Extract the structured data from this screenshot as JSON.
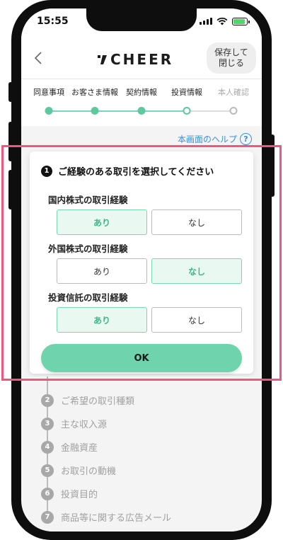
{
  "status_bar": {
    "time": "15:55"
  },
  "header": {
    "logo_text": "CHEER",
    "save_button": "保存して\n閉じる"
  },
  "steps": [
    {
      "label": "同意事項",
      "state": "done"
    },
    {
      "label": "お客さま情報",
      "state": "done"
    },
    {
      "label": "契約情報",
      "state": "done"
    },
    {
      "label": "投資情報",
      "state": "current"
    },
    {
      "label": "本人確認",
      "state": "future"
    }
  ],
  "help": {
    "label": "本画面のヘルプ",
    "icon_text": "?"
  },
  "question": {
    "number": "1",
    "title": "ご経験のある取引を選択してください",
    "groups": [
      {
        "label": "国内株式の取引経験",
        "options": [
          "あり",
          "なし"
        ],
        "selected": "あり"
      },
      {
        "label": "外国株式の取引経験",
        "options": [
          "あり",
          "なし"
        ],
        "selected": "なし"
      },
      {
        "label": "投資信託の取引経験",
        "options": [
          "あり",
          "なし"
        ],
        "selected": "あり"
      }
    ],
    "ok_label": "OK"
  },
  "remaining_items": [
    {
      "number": "2",
      "label": "ご希望の取引種類"
    },
    {
      "number": "3",
      "label": "主な収入源"
    },
    {
      "number": "4",
      "label": "金融資産"
    },
    {
      "number": "5",
      "label": "お取引の動機"
    },
    {
      "number": "6",
      "label": "投資目的"
    },
    {
      "number": "7",
      "label": "商品等に関する広告メール"
    }
  ],
  "colors": {
    "accent": "#5cc9a0",
    "accent_light": "#eaf8f2",
    "link": "#3b8fd9",
    "highlight": "#ec5882"
  }
}
